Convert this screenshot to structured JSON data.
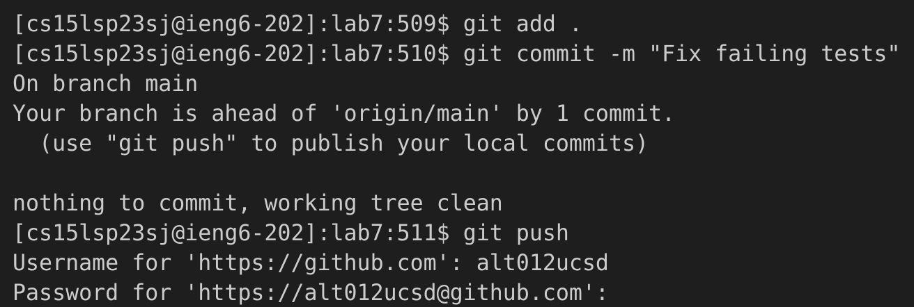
{
  "terminal": {
    "colors": {
      "background": "#1e1e1e",
      "foreground": "#cccccc"
    },
    "lines": [
      "[cs15lsp23sj@ieng6-202]:lab7:509$ git add .",
      "[cs15lsp23sj@ieng6-202]:lab7:510$ git commit -m \"Fix failing tests\"",
      "On branch main",
      "Your branch is ahead of 'origin/main' by 1 commit.",
      "  (use \"git push\" to publish your local commits)",
      "",
      "nothing to commit, working tree clean",
      "[cs15lsp23sj@ieng6-202]:lab7:511$ git push",
      "Username for 'https://github.com': alt012ucsd",
      "Password for 'https://alt012ucsd@github.com':"
    ]
  }
}
